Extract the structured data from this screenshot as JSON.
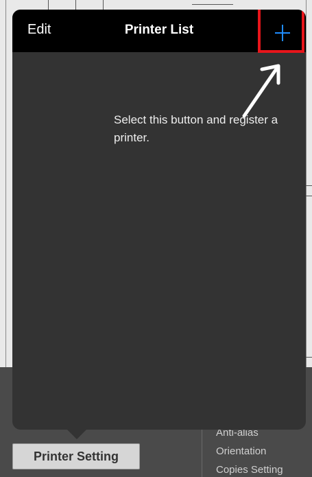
{
  "nav": {
    "edit_label": "Edit",
    "title": "Printer List",
    "add_symbol": "+"
  },
  "hint_text": "Select this button and register a printer.",
  "bottom": {
    "printer_setting_label": "Printer Setting",
    "settings": [
      "Anti-alias",
      "Orientation",
      "Copies Setting"
    ]
  },
  "colors": {
    "accent": "#1f8cff",
    "highlight": "#e8151b",
    "popover_bg": "#333333",
    "nav_bg": "#000000"
  }
}
